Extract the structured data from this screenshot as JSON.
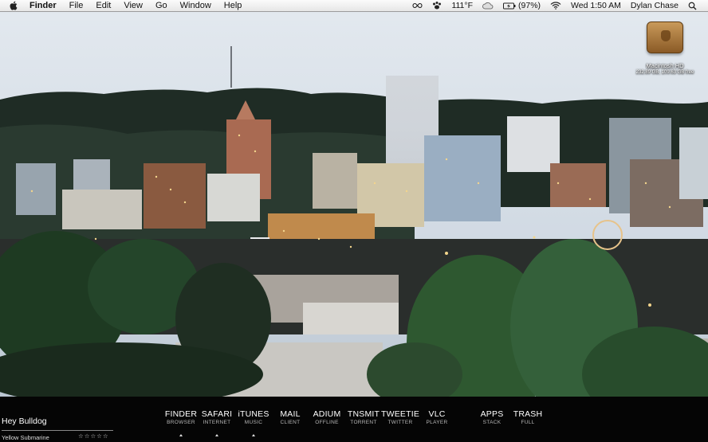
{
  "menubar": {
    "app_name": "Finder",
    "menus": [
      "File",
      "Edit",
      "View",
      "Go",
      "Window",
      "Help"
    ],
    "status": {
      "temperature": "111°F",
      "battery": "(97%)",
      "datetime": "Wed 1:50 AM",
      "user": "Dylan Chase"
    }
  },
  "desktop": {
    "disk_name": "Macintosh HD",
    "disk_info": "232.89 GB, 109.63 GB free"
  },
  "dock": {
    "items": [
      {
        "label": "FINDER",
        "sub": "BROWSER",
        "running": true
      },
      {
        "label": "SAFARI",
        "sub": "INTERNET",
        "running": true
      },
      {
        "label": "iTUNES",
        "sub": "MUSIC",
        "running": true
      },
      {
        "label": "MAIL",
        "sub": "CLIENT",
        "running": false
      },
      {
        "label": "ADIUM",
        "sub": "OFFLINE",
        "running": false
      },
      {
        "label": "TNSMIT",
        "sub": "TORRENT",
        "running": false
      },
      {
        "label": "TWEETIE",
        "sub": "TWITTER",
        "running": false
      },
      {
        "label": "VLC",
        "sub": "PLAYER",
        "running": false
      },
      {
        "label": "APPS",
        "sub": "STACK",
        "running": false
      },
      {
        "label": "TRASH",
        "sub": "FULL",
        "running": false
      }
    ]
  },
  "now_playing": {
    "title": "Hey Bulldog",
    "song": "Yellow Submarine",
    "rating": "☆☆☆☆☆"
  },
  "colors": {
    "menubar": "#ececec",
    "dock": "#050505",
    "sky": "#cfd9e3"
  }
}
